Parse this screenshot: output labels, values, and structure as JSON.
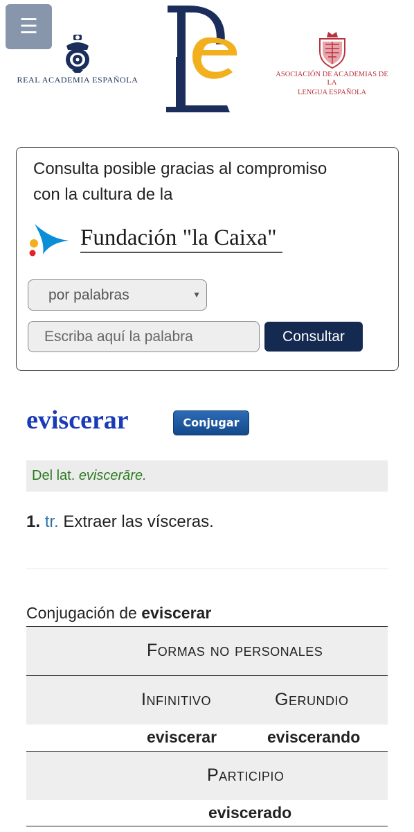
{
  "header": {
    "menu_icon": "hamburger-icon",
    "rae_name": "REAL ACADEMIA ESPAÑOLA",
    "asale_name_line1": "ASOCIACIÓN DE ACADEMIAS DE LA",
    "asale_name_line2": "LENGUA ESPAÑOLA"
  },
  "search": {
    "sponsor_line1": "Consulta posible gracias al compromiso",
    "sponsor_line2": "con la cultura de la",
    "sponsor_logo_text": "Fundación \"la Caixa\"",
    "mode_select": "por palabras",
    "input_placeholder": "Escriba aquí la palabra",
    "submit_label": "Consultar"
  },
  "entry": {
    "headword": "eviscerar",
    "conjugate_label": "Conjugar",
    "etym_prefix": "Del lat. ",
    "etym_word": "eviscerāre.",
    "def_number": "1.",
    "def_abbr": "tr.",
    "def_text": " Extraer las vísceras."
  },
  "conjugation": {
    "title_prefix": "Conjugación de ",
    "title_word": "eviscerar",
    "forms_header": "Formas no personales",
    "infinitive_label": "Infinitivo",
    "gerund_label": "Gerundio",
    "infinitive_value": "eviscerar",
    "gerund_value": "eviscerando",
    "participle_label": "Participio",
    "participle_value": "eviscerado"
  },
  "colors": {
    "menu_bg": "#8796ab",
    "rae_blue": "#1b2d5a",
    "dle_gold": "#f2b01e",
    "asale_red": "#b8323f",
    "headword_blue": "#1a3ab8",
    "etym_green": "#2a7a1e",
    "abbr_blue": "#2b73a8",
    "button_navy": "#142a50"
  }
}
